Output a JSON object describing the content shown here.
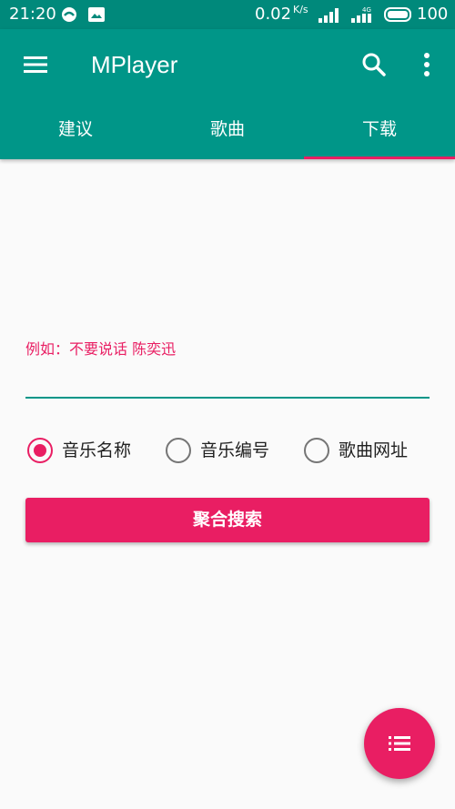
{
  "status_bar": {
    "time": "21:20",
    "net_speed": "0.02",
    "net_speed_unit": "K/s",
    "network_type": "4G",
    "battery": "100"
  },
  "app_bar": {
    "title": "MPlayer",
    "background": "#009688",
    "icons": [
      "menu-icon",
      "search-icon",
      "more-vert-icon"
    ]
  },
  "tabs": [
    {
      "label": "建议",
      "selected": false
    },
    {
      "label": "歌曲",
      "selected": false
    },
    {
      "label": "下载",
      "selected": true
    }
  ],
  "search_form": {
    "hint": "例如：不要说话 陈奕迅",
    "value": "",
    "radio_options": [
      {
        "label": "音乐名称",
        "checked": true
      },
      {
        "label": "音乐编号",
        "checked": false
      },
      {
        "label": "歌曲网址",
        "checked": false
      }
    ],
    "button_label": "聚合搜索"
  },
  "fab": {
    "icon": "list-icon"
  },
  "colors": {
    "primary": "#009688",
    "primary_dark": "#00897b",
    "accent": "#e91e63"
  }
}
